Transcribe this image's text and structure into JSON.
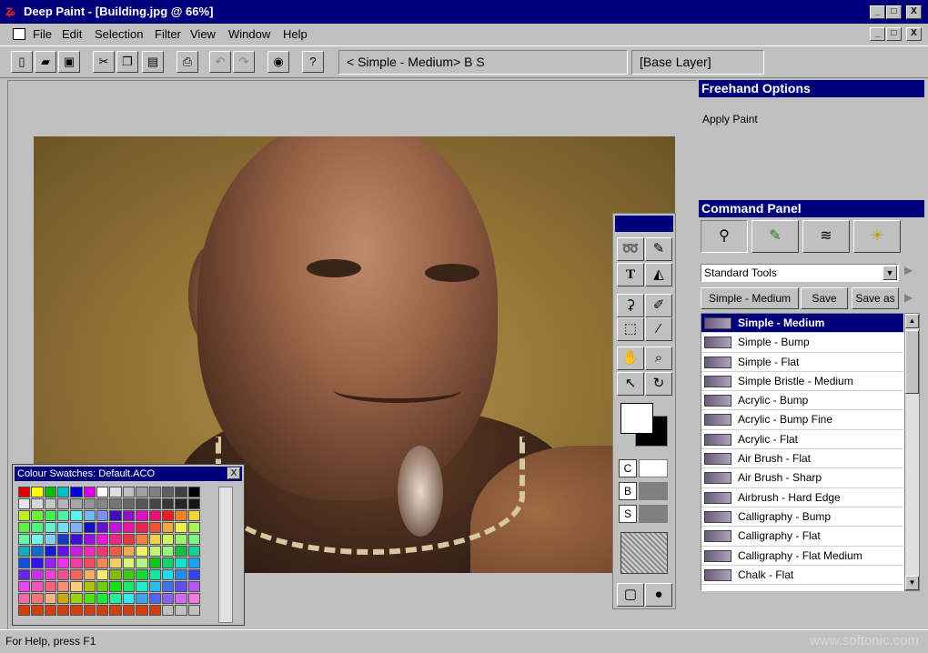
{
  "window": {
    "title": "Deep Paint - [Building.jpg @ 66%]",
    "app_icon": "paint-brush-icon",
    "controls": [
      "_",
      "□",
      "X"
    ],
    "doc_controls": [
      "_",
      "□",
      "X"
    ]
  },
  "menu": {
    "items": [
      "File",
      "Edit",
      "Selection",
      "Filter",
      "View",
      "Window",
      "Help"
    ]
  },
  "toolbar": {
    "buttons": [
      "new-icon",
      "open-icon",
      "save-icon",
      "cut-icon",
      "copy-icon",
      "paste-icon",
      "print-icon",
      "undo-icon",
      "redo-icon",
      "globe-icon",
      "help-icon"
    ],
    "brush_field": "<  Simple - Medium>  B S",
    "layer_field": "[Base Layer]"
  },
  "freehand": {
    "title": "Freehand Options",
    "text": "Apply Paint"
  },
  "command": {
    "title": "Command Panel",
    "tabs": [
      "brush-tab-icon",
      "paint-tab-icon",
      "layers-tab-icon",
      "bulb-tab-icon"
    ],
    "dropdown": "Standard Tools",
    "preset_label": "Simple - Medium",
    "save_label": "Save",
    "saveas_label": "Save as"
  },
  "brushes": [
    "Simple - Medium",
    "Simple - Bump",
    "Simple - Flat",
    "Simple Bristle - Medium",
    "Acrylic - Bump",
    "Acrylic - Bump Fine",
    "Acrylic - Flat",
    "Air Brush - Flat",
    "Air Brush - Sharp",
    "Airbrush - Hard Edge",
    "Calligraphy - Bump",
    "Calligraphy - Flat",
    "Calligraphy - Flat Medium",
    "Chalk - Flat"
  ],
  "tools": {
    "items": [
      "lasso-icon",
      "brush-icon",
      "text-icon",
      "fill-icon",
      "stamp-icon",
      "pen-icon",
      "marquee-icon",
      "wand-icon",
      "hand-icon",
      "zoom-icon",
      "pointer-icon",
      "rotate-icon"
    ],
    "cbs": [
      "C",
      "B",
      "S"
    ]
  },
  "swatches": {
    "title": "Colour Swatches: Default.ACO",
    "close": "X"
  },
  "status": {
    "text": "For Help, press F1",
    "watermark": "www.softonic.com"
  },
  "colors": {
    "titlebar": "#00007b",
    "face": "#c0c0c0"
  }
}
